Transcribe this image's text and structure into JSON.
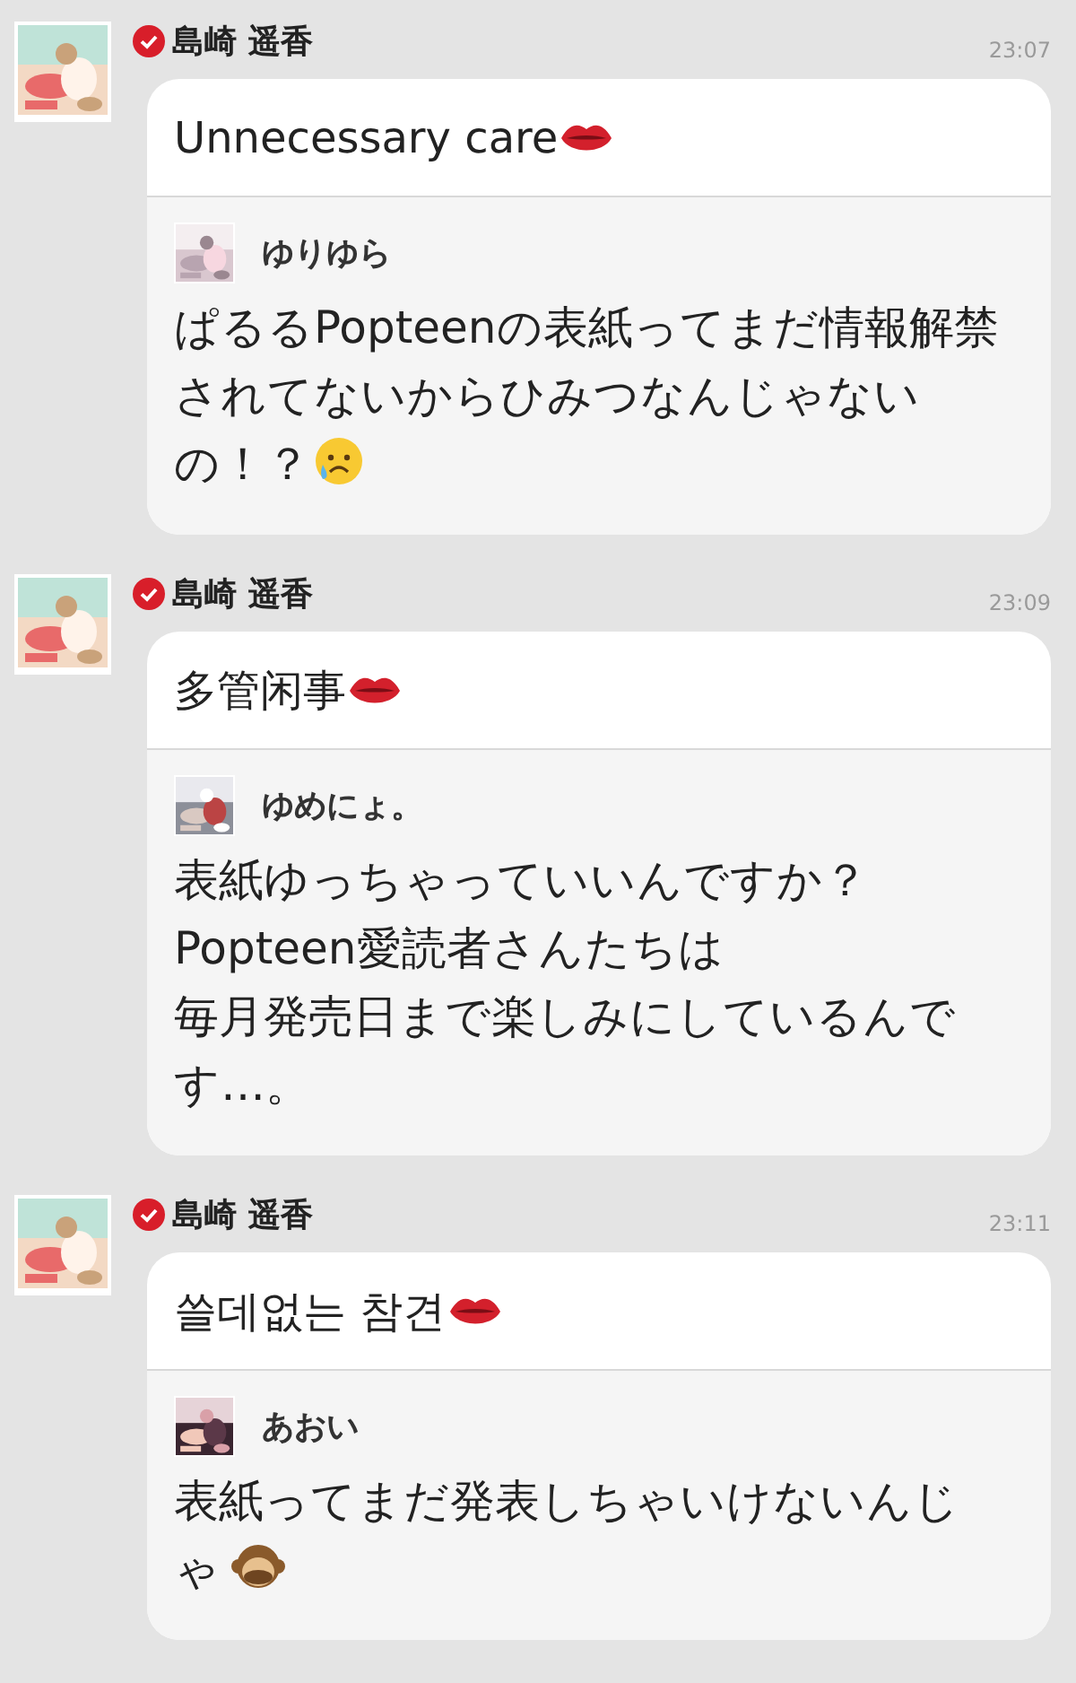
{
  "messages": [
    {
      "sender": "島崎 遥香",
      "verified": true,
      "time": "23:07",
      "text": "Unnecessary care",
      "emoji": {
        "kind": "lips"
      },
      "quote": {
        "author": "ゆりゆら",
        "text": "ぱるるPopteenの表紙ってまだ情報解禁されてないからひみつなんじゃないの！？",
        "emoji": {
          "kind": "sad"
        }
      }
    },
    {
      "sender": "島崎 遥香",
      "verified": true,
      "time": "23:09",
      "text": "多管闲事",
      "emoji": {
        "kind": "lips"
      },
      "quote": {
        "author": "ゆめにょ。",
        "lines": [
          "表紙ゆっちゃっていいんですか？",
          "Popteen愛読者さんたちは",
          "毎月発売日まで楽しみにしているんです…。"
        ]
      }
    },
    {
      "sender": "島崎 遥香",
      "verified": true,
      "time": "23:11",
      "text": "쓸데없는 참견",
      "emoji": {
        "kind": "lips"
      },
      "quote": {
        "author": "あおい",
        "text": "表紙ってまだ発表しちゃいけないんじゃ",
        "emoji": {
          "kind": "monkey"
        }
      }
    }
  ]
}
